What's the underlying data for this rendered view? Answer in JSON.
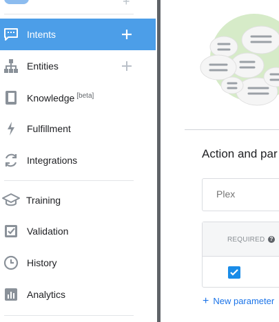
{
  "sidebar": {
    "items": [
      {
        "id": "intents",
        "label": "Intents",
        "icon": "chat-bubble-icon",
        "active": true,
        "has_add": true
      },
      {
        "id": "entities",
        "label": "Entities",
        "icon": "hierarchy-icon",
        "active": false,
        "has_add": true
      },
      {
        "id": "knowledge",
        "label": "Knowledge",
        "badge": "[beta]",
        "icon": "book-icon",
        "active": false
      },
      {
        "id": "fulfillment",
        "label": "Fulfillment",
        "icon": "lightning-icon",
        "active": false
      },
      {
        "id": "integrations",
        "label": "Integrations",
        "icon": "sync-icon",
        "active": false
      },
      {
        "id": "training",
        "label": "Training",
        "icon": "graduation-cap-icon",
        "active": false
      },
      {
        "id": "validation",
        "label": "Validation",
        "icon": "checklist-icon",
        "active": false
      },
      {
        "id": "history",
        "label": "History",
        "icon": "clock-icon",
        "active": false
      },
      {
        "id": "analytics",
        "label": "Analytics",
        "icon": "bar-chart-icon",
        "active": false
      }
    ]
  },
  "main": {
    "section_title": "Action and par",
    "action_input": {
      "placeholder": "Plex"
    },
    "table": {
      "header_required": "REQUIRED",
      "help_glyph": "?",
      "rows": [
        {
          "required": true
        }
      ]
    },
    "new_parameter_label": "New parameter"
  },
  "colors": {
    "accent": "#4c9ee8",
    "checkbox": "#1a8ce8",
    "link": "#1a73e8",
    "sidebar_icon": "#8a9199",
    "illustration_circle": "#d6ebc8"
  }
}
